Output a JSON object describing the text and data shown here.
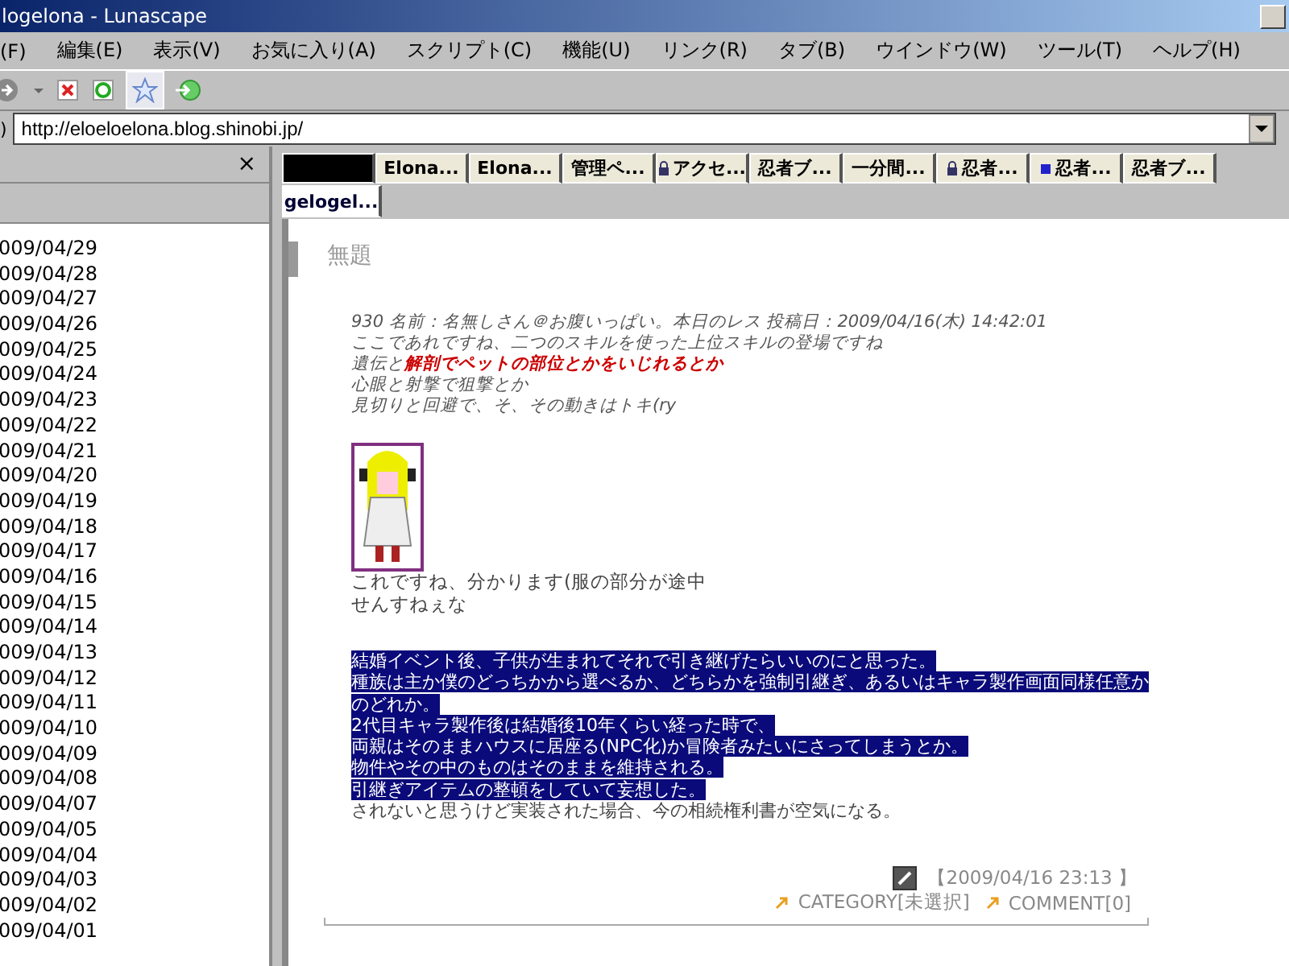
{
  "window": {
    "title": "logelona - Lunascape"
  },
  "menu": [
    "(F)",
    "編集(E)",
    "表示(V)",
    "お気に入り(A)",
    "スクリプト(C)",
    "機能(U)",
    "リンク(R)",
    "タブ(B)",
    "ウインドウ(W)",
    "ツール(T)",
    "ヘルプ(H)"
  ],
  "address": {
    "label": ")",
    "value": "http://eloeloelona.blog.shinobi.jp/"
  },
  "sidebar": {
    "close": "×",
    "dates": [
      "009/04/29",
      "009/04/28",
      "009/04/27",
      "009/04/26",
      "009/04/25",
      "009/04/24",
      "009/04/23",
      "009/04/22",
      "009/04/21",
      "009/04/20",
      "009/04/19",
      "009/04/18",
      "009/04/17",
      "009/04/16",
      "009/04/15",
      "009/04/14",
      "009/04/13",
      "009/04/12",
      "009/04/11",
      "009/04/10",
      "009/04/09",
      "009/04/08",
      "009/04/07",
      "009/04/05",
      "009/04/04",
      "009/04/03",
      "009/04/02",
      "009/04/01"
    ]
  },
  "tabs": [
    {
      "kind": "blank",
      "selected": false
    },
    {
      "kind": "plain",
      "label": "Elona...",
      "selected": false
    },
    {
      "kind": "plain",
      "label": "Elona...",
      "selected": false
    },
    {
      "kind": "plain",
      "label": "管理ペ...",
      "selected": false
    },
    {
      "kind": "lock",
      "label": "アクセ...",
      "selected": false
    },
    {
      "kind": "plain",
      "label": "忍者ブ...",
      "selected": false
    },
    {
      "kind": "plain",
      "label": "一分間...",
      "selected": false
    },
    {
      "kind": "lock",
      "label": "忍者...",
      "selected": false
    },
    {
      "kind": "square",
      "label": "忍者...",
      "selected": false
    },
    {
      "kind": "plain",
      "label": "忍者ブ...",
      "selected": false
    },
    {
      "kind": "plain",
      "label": "gelogel...",
      "selected": true
    }
  ],
  "post": {
    "title": "無題",
    "quote": [
      "930 名前：名無しさん＠お腹いっぱい。本日のレス 投稿日：2009/04/16(木) 14:42:01",
      "ここであれですね、二つのスキルを使った上位スキルの登場ですね",
      "遺伝と**解剖でペットの部位とかをいじれるとか**",
      "心眼と射撃で狙撃とか",
      "見切りと回避で、そ、その動きはトキ(ry"
    ],
    "caption": [
      "これですね、分かります(服の部分が途中",
      "せんすねぇな"
    ],
    "body": [
      {
        "text": "結婚イベント後、子供が生まれてそれで引き継げたらいいのにと思った。",
        "selected": true
      },
      {
        "text": "種族は主か僕のどっちかから選べるか、どちらかを強制引継ぎ、あるいはキャラ製作画面同様任意か",
        "selected": true
      },
      {
        "text": "のどれか。",
        "selected": true
      },
      {
        "text": "2代目キャラ製作後は結婚後10年くらい経った時で、",
        "selected": true
      },
      {
        "text": "両親はそのままハウスに居座る(NPC化)か冒険者みたいにさってしまうとか。",
        "selected": true
      },
      {
        "text": "物件やその中のものはそのままを維持される。",
        "selected": true
      },
      {
        "text": "引継ぎアイテムの整頓をしていて妄想した。",
        "selected": true
      },
      {
        "text": "されないと思うけど実装された場合、今の相続権利書が空気になる。",
        "selected": false
      }
    ],
    "date": "【2009/04/16 23:13 】",
    "category": "CATEGORY[未選択]",
    "comment": "COMMENT[0]"
  }
}
